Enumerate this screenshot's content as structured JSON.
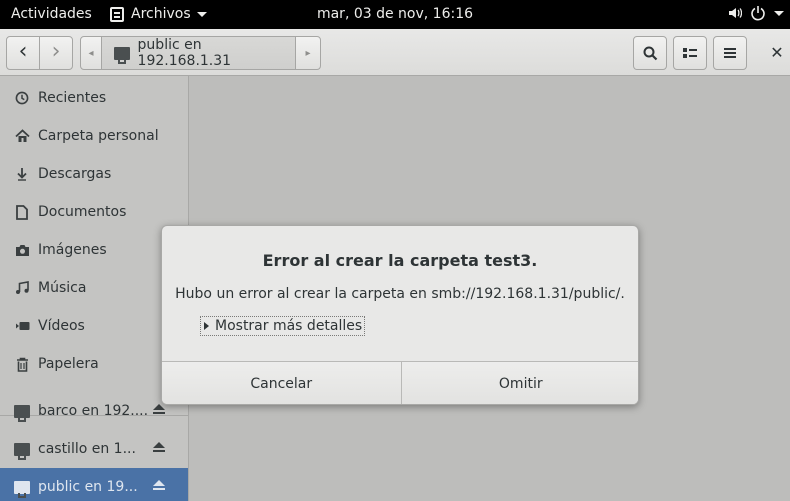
{
  "topbar": {
    "activities": "Actividades",
    "app_name": "Archivos",
    "clock": "mar, 03 de nov, 16:16",
    "icons": [
      "volume-icon",
      "power-icon"
    ]
  },
  "headerbar": {
    "back_icon": "‹",
    "forward_icon": "›",
    "path_left_icon": "◂",
    "path_right_icon": "▸",
    "location": "public en 192.168.1.31",
    "search_icon": "search-icon",
    "view_icon": "list-view-icon",
    "menu_icon": "hamburger-menu-icon",
    "close_icon": "✕"
  },
  "sidebar": {
    "places": [
      {
        "label": "Recientes",
        "icon": "clock-icon"
      },
      {
        "label": "Carpeta personal",
        "icon": "home-icon"
      },
      {
        "label": "Descargas",
        "icon": "download-icon"
      },
      {
        "label": "Documentos",
        "icon": "document-icon"
      },
      {
        "label": "Imágenes",
        "icon": "camera-icon"
      },
      {
        "label": "Música",
        "icon": "music-icon"
      },
      {
        "label": "Vídeos",
        "icon": "video-icon"
      },
      {
        "label": "Papelera",
        "icon": "trash-icon"
      }
    ],
    "network": [
      {
        "label": "barco en 192....",
        "icon": "network-folder-icon"
      },
      {
        "label": "castillo en 1...",
        "icon": "network-folder-icon"
      },
      {
        "label": "public en 19...",
        "icon": "network-folder-icon",
        "selected": true
      }
    ],
    "selected_color": "#4a72a6"
  },
  "dialog": {
    "title": "Error al crear la carpeta test3.",
    "message": "Hubo un error al crear la carpeta en smb://192.168.1.31/public/.",
    "details": "Mostrar más detalles",
    "cancel": "Cancelar",
    "skip": "Omitir"
  }
}
